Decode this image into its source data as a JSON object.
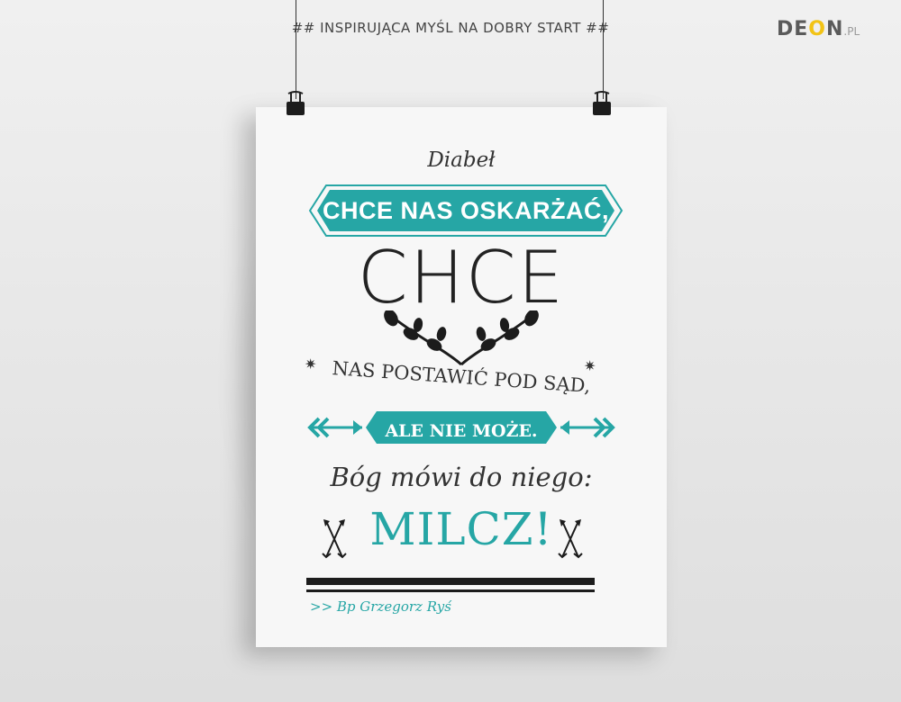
{
  "header": {
    "text": "## INSPIRUJĄCA MYŚL NA DOBRY START ##"
  },
  "logo": {
    "main_before": "DE",
    "main_o": "O",
    "main_after": "N",
    "suffix": ".PL"
  },
  "poster": {
    "line1": "Diabeł",
    "banner": "CHCE NAS OSKARŻAĆ,",
    "big_word": "CHCE",
    "line3": "NAS POSTAWIĆ POD SĄD,",
    "arrow_banner": "ALE NIE MOŻE.",
    "line5": "Bóg mówi do niego:",
    "emphasis": "MILCZ!",
    "author": ">> Bp Grzegorz Ryś"
  },
  "colors": {
    "accent": "#26a6a5",
    "dark": "#1c1c1c",
    "logo_accent": "#f2c316"
  },
  "icons": {
    "laurel": "laurel-branch-icon",
    "star": "asterisk-star-icon",
    "arrow": "arrow-icon",
    "crossed_arrows": "crossed-arrows-icon",
    "clip": "binder-clip-icon"
  }
}
